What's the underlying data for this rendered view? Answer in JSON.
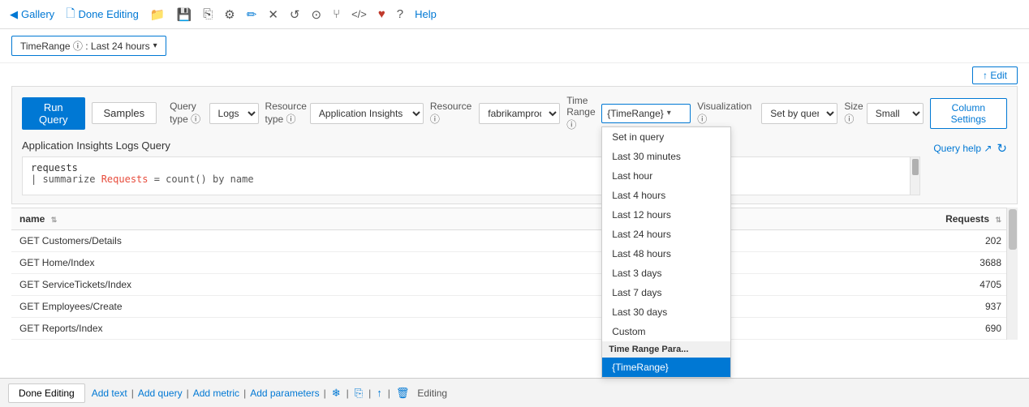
{
  "toolbar": {
    "gallery_label": "Gallery",
    "done_editing_label": "Done Editing",
    "help_label": "Help",
    "icons": [
      {
        "name": "folder-icon",
        "symbol": "📁"
      },
      {
        "name": "save-icon",
        "symbol": "💾"
      },
      {
        "name": "copy-icon",
        "symbol": "⎘"
      },
      {
        "name": "settings-icon",
        "symbol": "⚙"
      },
      {
        "name": "pen-icon",
        "symbol": "✏"
      },
      {
        "name": "close-icon",
        "symbol": "✕"
      },
      {
        "name": "refresh-icon",
        "symbol": "↺"
      },
      {
        "name": "user-icon",
        "symbol": "👤"
      },
      {
        "name": "fork-icon",
        "symbol": "⑂"
      },
      {
        "name": "code-icon",
        "symbol": "</>"
      },
      {
        "name": "heart-icon",
        "symbol": "♥"
      },
      {
        "name": "question-icon",
        "symbol": "?"
      }
    ]
  },
  "filter_bar": {
    "pill_label": "TimeRange ⓘ : Last 24 hours"
  },
  "top_edit": {
    "button_label": "↑ Edit"
  },
  "query_panel": {
    "run_query_label": "Run Query",
    "samples_label": "Samples",
    "query_type_label": "Query type ⓘ",
    "query_type_value": "Logs",
    "resource_type_label": "Resource type ⓘ",
    "resource_type_value": "Application Insights",
    "resource_label": "Resource ⓘ",
    "resource_value": "fabrikamprod",
    "time_range_label": "Time Range ⓘ",
    "time_range_value": "{TimeRange}",
    "visualization_label": "Visualization ⓘ",
    "visualization_value": "Set by query",
    "size_label": "Size ⓘ",
    "size_value": "Small",
    "column_settings_label": "Column Settings",
    "query_title": "Application Insights Logs Query",
    "query_help_label": "Query help ↗",
    "code_line1": "requests",
    "code_line2": "| summarize Requests = count() by name"
  },
  "time_range_dropdown": {
    "items": [
      {
        "label": "Set in query",
        "state": "normal"
      },
      {
        "label": "Last 30 minutes",
        "state": "normal"
      },
      {
        "label": "Last hour",
        "state": "normal"
      },
      {
        "label": "Last 4 hours",
        "state": "normal"
      },
      {
        "label": "Last 12 hours",
        "state": "normal"
      },
      {
        "label": "Last 24 hours",
        "state": "normal"
      },
      {
        "label": "Last 48 hours",
        "state": "normal"
      },
      {
        "label": "Last 3 days",
        "state": "normal"
      },
      {
        "label": "Last 7 days",
        "state": "normal"
      },
      {
        "label": "Last 30 days",
        "state": "normal"
      },
      {
        "label": "Custom",
        "state": "normal"
      },
      {
        "label": "Time Range Para...",
        "state": "section-header"
      },
      {
        "label": "{TimeRange}",
        "state": "selected"
      }
    ]
  },
  "table": {
    "columns": [
      {
        "id": "name",
        "label": "name",
        "sortable": true
      },
      {
        "id": "requests",
        "label": "Requests",
        "sortable": true,
        "align": "right"
      }
    ],
    "rows": [
      {
        "name": "GET Customers/Details",
        "requests": "202"
      },
      {
        "name": "GET Home/Index",
        "requests": "3688"
      },
      {
        "name": "GET ServiceTickets/Index",
        "requests": "4705"
      },
      {
        "name": "GET Employees/Create",
        "requests": "937"
      },
      {
        "name": "GET Reports/Index",
        "requests": "690"
      }
    ]
  },
  "footer": {
    "done_editing_label": "Done Editing",
    "editing_label": "Editing",
    "add_text_label": "Add text",
    "add_query_label": "Add query",
    "add_metric_label": "Add metric",
    "add_parameters_label": "Add parameters",
    "sep": "|"
  }
}
